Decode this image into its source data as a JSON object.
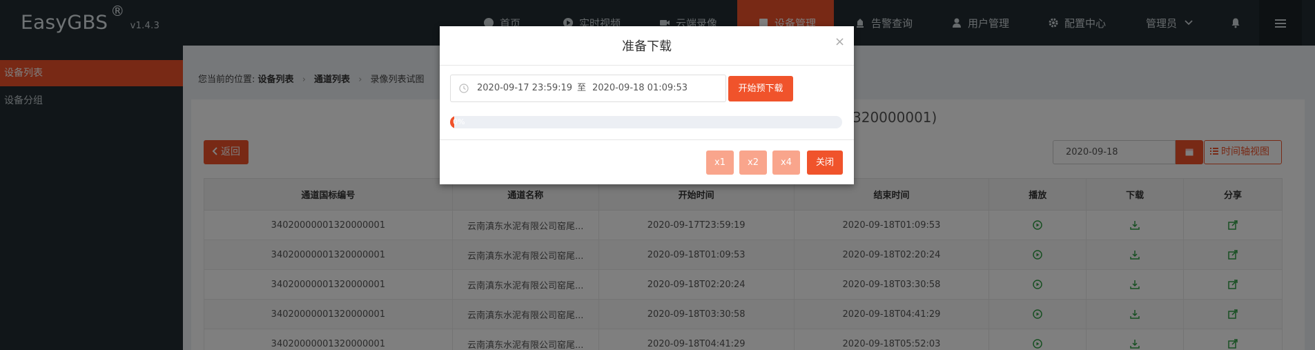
{
  "app": {
    "brand": "EasyGBS",
    "registered": "®",
    "version": "v1.4.3"
  },
  "nav": {
    "home": "首页",
    "live": "实时视频",
    "cloud": "云端录像",
    "device_mgmt": "设备管理",
    "alarm": "告警查询",
    "users": "用户管理",
    "config": "配置中心",
    "admin": "管理员"
  },
  "sidebar": {
    "items": [
      {
        "label": "设备列表"
      },
      {
        "label": "设备分组"
      }
    ]
  },
  "breadcrumb": {
    "prefix": "您当前的位置:",
    "crumb1": "设备列表",
    "crumb2": "通道列表",
    "crumb3": "录像列表试图"
  },
  "page": {
    "title_tail": "320000001)",
    "back_label": "返回",
    "date_value": "2020-09-18",
    "timeline_label": "时间轴视图"
  },
  "table": {
    "headers": [
      "通道国标编号",
      "通道名称",
      "开始时间",
      "结束时间",
      "播放",
      "下载",
      "分享"
    ],
    "rows": [
      {
        "id": "34020000001320000001",
        "name": "云南滇东水泥有限公司窑尾...",
        "start": "2020-09-17T23:59:19",
        "end": "2020-09-18T01:09:53"
      },
      {
        "id": "34020000001320000001",
        "name": "云南滇东水泥有限公司窑尾...",
        "start": "2020-09-18T01:09:53",
        "end": "2020-09-18T02:20:24"
      },
      {
        "id": "34020000001320000001",
        "name": "云南滇东水泥有限公司窑尾...",
        "start": "2020-09-18T02:20:24",
        "end": "2020-09-18T03:30:58"
      },
      {
        "id": "34020000001320000001",
        "name": "云南滇东水泥有限公司窑尾...",
        "start": "2020-09-18T03:30:58",
        "end": "2020-09-18T04:41:29"
      },
      {
        "id": "34020000001320000001",
        "name": "云南滇东水泥有限公司窑尾...",
        "start": "2020-09-18T04:41:29",
        "end": "2020-09-18T05:52:03"
      }
    ]
  },
  "modal": {
    "title": "准备下载",
    "close_glyph": "×",
    "range_from": "2020-09-17 23:59:19",
    "range_to_label": "至",
    "range_until": "2020-09-18 01:09:53",
    "start_label": "开始预下载",
    "progress_text": "0%",
    "progress_fraction": 0,
    "speed_x1": "x1",
    "speed_x2": "x2",
    "speed_x4": "x4",
    "close_label": "关闭"
  },
  "colors": {
    "accent": "#f0532b",
    "accent_light": "#f9a58c",
    "nav_bg": "#222d32",
    "icon_green": "#2f9e44"
  }
}
